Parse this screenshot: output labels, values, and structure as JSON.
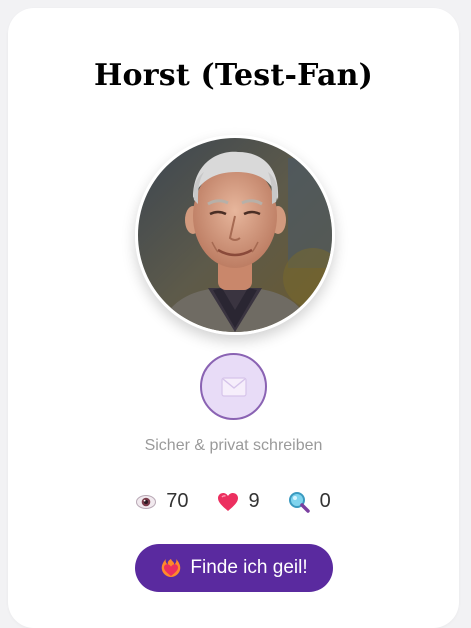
{
  "profile": {
    "name": "Horst (Test-Fan)",
    "avatar_icon": "profile-photo",
    "message_icon": "envelope-icon",
    "message_hint": "Sicher & privat schreiben"
  },
  "stats": {
    "views": {
      "icon": "eye-icon",
      "value": "70"
    },
    "likes": {
      "icon": "heart-icon",
      "value": "9"
    },
    "searches": {
      "icon": "magnifier-icon",
      "value": "0"
    }
  },
  "like_button": {
    "icon": "heart-fire-icon",
    "label": "Finde ich geil!"
  },
  "colors": {
    "accent": "#5a2a9f",
    "message_bg": "#e8dcf7",
    "message_border": "#8a63b3",
    "heart": "#e8305a"
  }
}
